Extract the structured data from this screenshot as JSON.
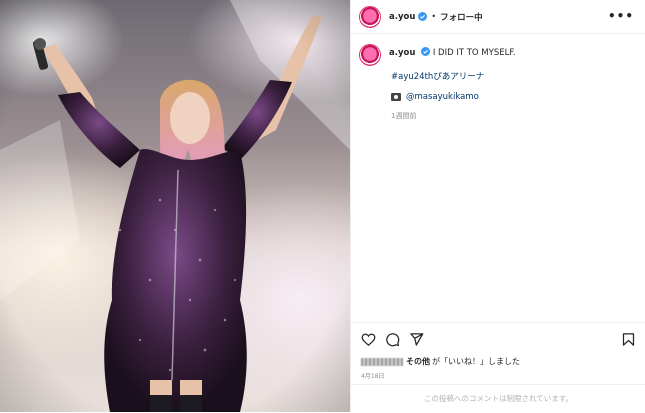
{
  "post": {
    "username": "a.you",
    "follow_label": "フォロー中",
    "separator": "•",
    "more_label": "•••",
    "caption": "I DID IT TO MYSELF.",
    "hashtag": "#ayu24thぴあアリーナ",
    "photo_credit": "@masayukikamo",
    "time_ago": "1週間前",
    "likes_name_suffix": "その他",
    "likes_text": "が「いいね！」しました",
    "date": "4月18日",
    "comments_disabled": "この投稿へのコメントは制限されています。"
  },
  "icons": [
    "heart-icon",
    "comment-icon",
    "share-icon",
    "bookmark-icon",
    "more-icon",
    "verified-icon",
    "camera-icon"
  ],
  "colors": {
    "link": "#00376b",
    "verified": "#3897f0",
    "avatar_ring": "#e1306c",
    "muted": "#8e8e8e"
  }
}
